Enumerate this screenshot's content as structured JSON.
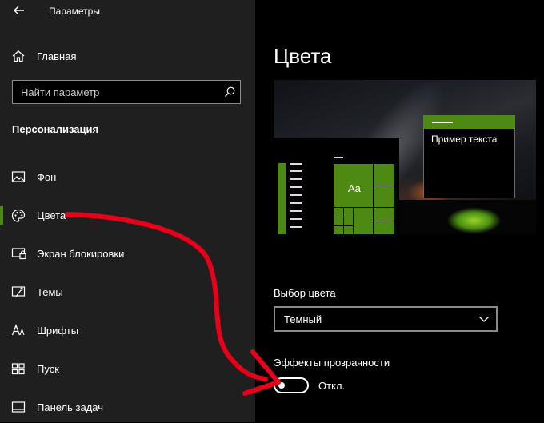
{
  "window": {
    "title": "Параметры"
  },
  "sidebar": {
    "home_label": "Главная",
    "search_placeholder": "Найти параметр",
    "section_title": "Персонализация",
    "items": [
      {
        "label": "Фон",
        "icon": "image-icon"
      },
      {
        "label": "Цвета",
        "icon": "palette-icon",
        "active": true
      },
      {
        "label": "Экран блокировки",
        "icon": "lock-screen-icon"
      },
      {
        "label": "Темы",
        "icon": "brush-icon"
      },
      {
        "label": "Шрифты",
        "icon": "font-icon"
      },
      {
        "label": "Пуск",
        "icon": "start-icon"
      },
      {
        "label": "Панель задач",
        "icon": "taskbar-icon"
      }
    ]
  },
  "main": {
    "title": "Цвета",
    "preview": {
      "sample_text": "Пример текста",
      "tile_text": "Aa"
    },
    "color_choice": {
      "label": "Выбор цвета",
      "value": "Темный"
    },
    "transparency": {
      "label": "Эффекты прозрачности",
      "state_label": "Откл.",
      "on": false
    }
  },
  "colors": {
    "accent": "#4c8a13",
    "sidebar_bg": "#1f1f1f",
    "main_bg": "#000000",
    "annotation_arrow": "#e8001a"
  }
}
